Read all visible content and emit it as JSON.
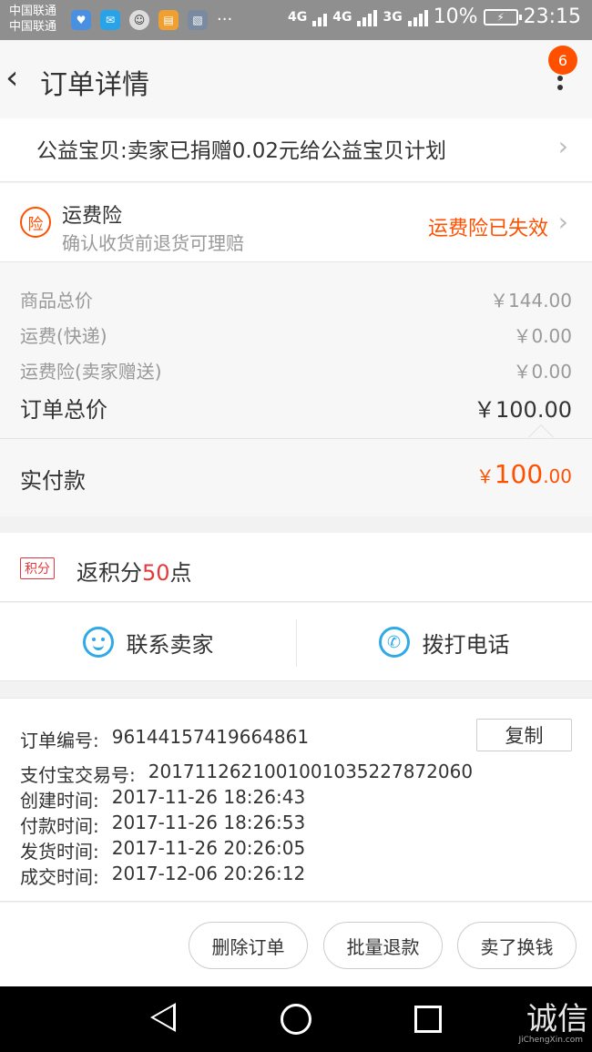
{
  "status_bar": {
    "carrier1": "中国联通",
    "carrier2": "中国联通",
    "signal1": "4G",
    "signal2": "4G",
    "signal3": "3G",
    "battery": "10%",
    "time": "23:15",
    "more": "···"
  },
  "header": {
    "title": "订单详情",
    "notification_count": "6"
  },
  "charity": {
    "text": "公益宝贝:卖家已捐赠0.02元给公益宝贝计划"
  },
  "insurance": {
    "icon_text": "险",
    "title": "运费险",
    "subtitle": "确认收货前退货可理赔",
    "status": "运费险已失效"
  },
  "prices": {
    "goods_label": "商品总价",
    "goods_value": "￥144.00",
    "shipping_label": "运费(快递)",
    "shipping_value": "￥0.00",
    "insurance_label": "运费险(卖家赠送)",
    "insurance_value": "￥0.00",
    "total_label": "订单总价",
    "total_value": "￥100.00"
  },
  "paid": {
    "label": "实付款",
    "currency": "￥",
    "integer": "100",
    "decimal": ".00"
  },
  "points": {
    "tag": "积分",
    "prefix": "返积分",
    "number": "50",
    "suffix": "点"
  },
  "contact": {
    "seller": "联系卖家",
    "phone": "拨打电话"
  },
  "order_info": {
    "order_no_label": "订单编号:",
    "order_no": "96144157419664861",
    "copy": "复制",
    "alipay_label": "支付宝交易号:",
    "alipay_no": "2017112621001001035227872060",
    "created_label": "创建时间:",
    "created": "2017-11-26 18:26:43",
    "paid_label": "付款时间:",
    "paid_time": "2017-11-26 18:26:53",
    "shipped_label": "发货时间:",
    "shipped": "2017-11-26 20:26:05",
    "done_label": "成交时间:",
    "done": "2017-12-06 20:26:12"
  },
  "actions": {
    "delete": "删除订单",
    "refund": "批量退款",
    "sell": "卖了换钱"
  },
  "watermark": {
    "text": "诚信",
    "sub": "JiChengXin.com"
  }
}
